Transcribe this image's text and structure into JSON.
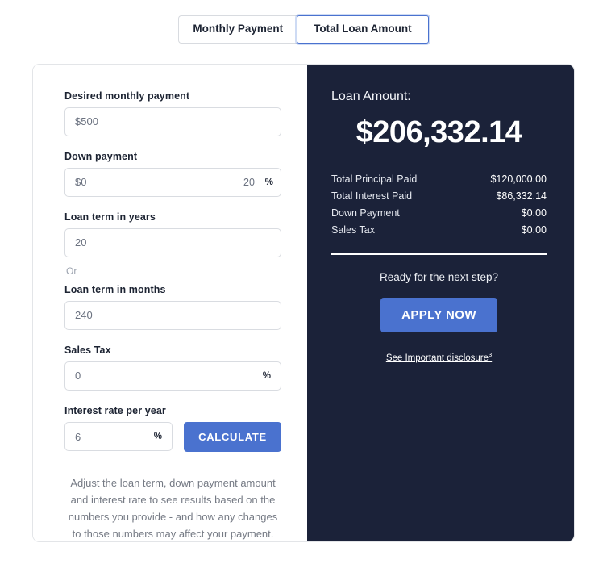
{
  "tabs": [
    {
      "label": "Monthly Payment",
      "active": false
    },
    {
      "label": "Total Loan Amount",
      "active": true
    }
  ],
  "form": {
    "desired_monthly_payment": {
      "label": "Desired monthly payment",
      "value": "$500"
    },
    "down_payment": {
      "label": "Down payment",
      "value": "$0",
      "percent_value": "20",
      "percent_symbol": "%"
    },
    "loan_term_years": {
      "label": "Loan term in years",
      "value": "20"
    },
    "or_divider": "Or",
    "loan_term_months": {
      "label": "Loan term in months",
      "value": "240"
    },
    "sales_tax": {
      "label": "Sales Tax",
      "value": "0",
      "percent_symbol": "%"
    },
    "interest_rate": {
      "label": "Interest rate per year",
      "value": "6",
      "percent_symbol": "%"
    },
    "calculate_button": "CALCULATE",
    "helper_text": "Adjust the loan term, down payment amount and interest rate to see results based on the numbers you provide - and how any changes to those numbers may affect your payment."
  },
  "results": {
    "title": "Loan Amount:",
    "amount": "$206,332.14",
    "breakdown": [
      {
        "label": "Total Principal Paid",
        "value": "$120,000.00"
      },
      {
        "label": "Total Interest Paid",
        "value": "$86,332.14"
      },
      {
        "label": "Down Payment",
        "value": "$0.00"
      },
      {
        "label": "Sales Tax",
        "value": "$0.00"
      }
    ],
    "next_step_text": "Ready for the next step?",
    "apply_button": "APPLY NOW",
    "disclosure_text": "See Important disclosure",
    "disclosure_marker": "3"
  },
  "colors": {
    "accent_blue": "#4a72cf",
    "panel_dark": "#1b2239",
    "text_dark": "#1d2433",
    "text_muted": "#767b85"
  }
}
